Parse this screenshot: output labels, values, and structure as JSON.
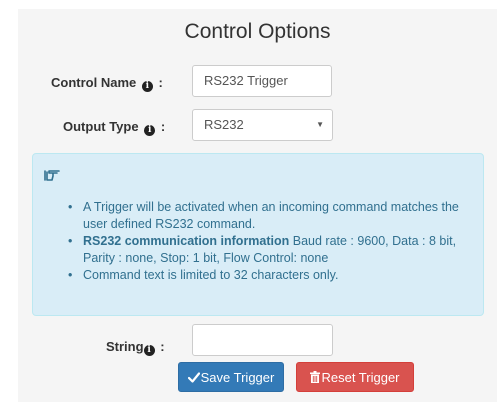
{
  "form": {
    "title": "Control Options",
    "control_name_label": "Control Name",
    "control_name_value": "RS232 Trigger",
    "output_type_label": "Output Type",
    "output_type_value": "RS232",
    "string_label": "String",
    "string_value": "",
    "colon": ":"
  },
  "info": {
    "icon": "hand-point-right-icon",
    "items": [
      {
        "text": "A Trigger will be activated when an incoming command matches the user defined RS232 command."
      },
      {
        "bold": "RS232 communication information",
        "text": " Baud rate : 9600, Data : 8 bit, Parity : none, Stop: 1 bit, Flow Control: none"
      },
      {
        "text": "Command text is limited to 32 characters only."
      }
    ]
  },
  "buttons": {
    "save_label": "Save Trigger",
    "save_icon": "check-icon",
    "reset_label": "Reset Trigger",
    "reset_icon": "trash-icon"
  },
  "colors": {
    "panel_bg": "#f5f5f5",
    "alert_bg": "#d9edf7",
    "alert_text": "#31708f",
    "save_button": "#337ab7",
    "reset_button": "#d9534f"
  }
}
